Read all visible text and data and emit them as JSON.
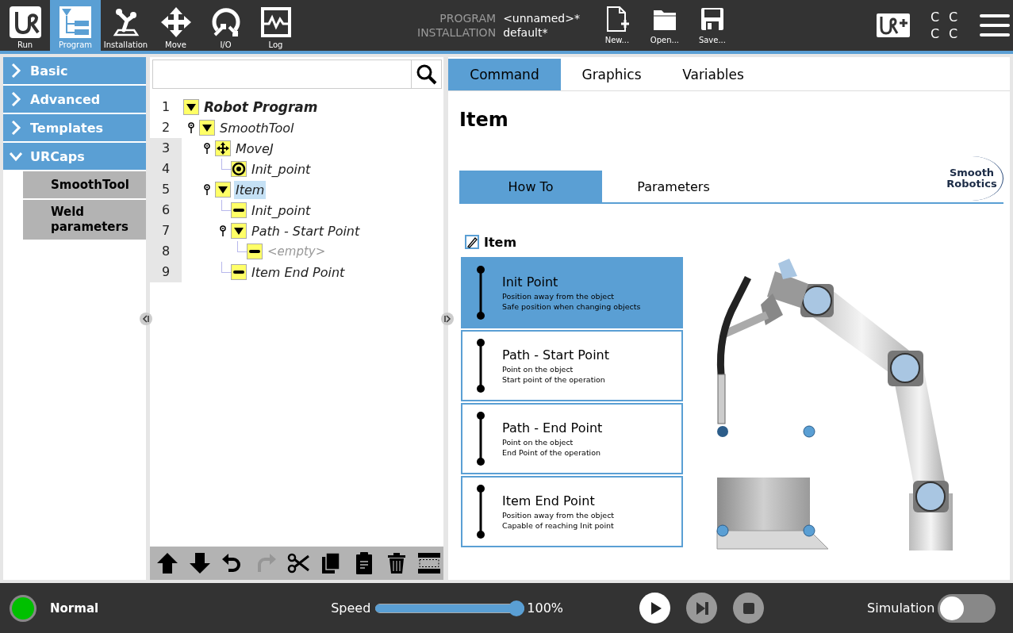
{
  "header": {
    "nav": [
      {
        "label": "Run",
        "kind": "run",
        "selected": false
      },
      {
        "label": "Program",
        "kind": "program",
        "selected": true
      },
      {
        "label": "Installation",
        "kind": "installation",
        "selected": false
      },
      {
        "label": "Move",
        "kind": "move",
        "selected": false
      },
      {
        "label": "I/O",
        "kind": "io",
        "selected": false
      },
      {
        "label": "Log",
        "kind": "log",
        "selected": false
      }
    ],
    "program": {
      "label": "PROGRAM",
      "value": "<unnamed>*"
    },
    "installation": {
      "label": "INSTALLATION",
      "value": "default*"
    },
    "file_buttons": [
      {
        "label": "New...",
        "kind": "new"
      },
      {
        "label": "Open...",
        "kind": "open"
      },
      {
        "label": "Save...",
        "kind": "save"
      }
    ],
    "status_letters": [
      "C",
      "C",
      "C",
      "C"
    ]
  },
  "sidebar": {
    "items": [
      {
        "label": "Basic",
        "expanded": false
      },
      {
        "label": "Advanced",
        "expanded": false
      },
      {
        "label": "Templates",
        "expanded": false
      },
      {
        "label": "URCaps",
        "expanded": true,
        "children": [
          {
            "label": "SmoothTool"
          },
          {
            "label": "Weld parameters"
          }
        ]
      }
    ]
  },
  "program_tree": {
    "nodes": [
      {
        "line": "1",
        "label": "Robot Program",
        "kind": "folder",
        "expanded": true,
        "shaded": false,
        "selected": false,
        "empty": false,
        "children": [
          {
            "line": "2",
            "label": "SmoothTool",
            "kind": "folder",
            "expanded": true,
            "shaded": false,
            "selected": false,
            "empty": false,
            "children": [
              {
                "line": "3",
                "label": "MoveJ",
                "kind": "move",
                "expanded": true,
                "shaded": true,
                "selected": false,
                "empty": false,
                "children": [
                  {
                    "line": "4",
                    "label": "Init_point",
                    "kind": "waypoint",
                    "shaded": true,
                    "selected": false,
                    "empty": false
                  }
                ]
              },
              {
                "line": "5",
                "label": "Item",
                "kind": "folder",
                "expanded": true,
                "shaded": true,
                "selected": true,
                "empty": false,
                "children": [
                  {
                    "line": "6",
                    "label": "Init_point",
                    "kind": "point",
                    "shaded": true,
                    "selected": false,
                    "empty": false
                  },
                  {
                    "line": "7",
                    "label": "Path - Start Point",
                    "kind": "folder",
                    "expanded": true,
                    "shaded": true,
                    "selected": false,
                    "empty": false,
                    "children": [
                      {
                        "line": "8",
                        "label": "<empty>",
                        "kind": "point",
                        "shaded": true,
                        "selected": false,
                        "empty": true
                      }
                    ]
                  },
                  {
                    "line": "9",
                    "label": "Item End Point",
                    "kind": "point",
                    "shaded": true,
                    "selected": false,
                    "empty": false
                  }
                ]
              }
            ]
          }
        ]
      }
    ]
  },
  "tree_toolbar": [
    {
      "kind": "up",
      "disabled": false
    },
    {
      "kind": "down",
      "disabled": false
    },
    {
      "kind": "undo",
      "disabled": false
    },
    {
      "kind": "redo",
      "disabled": true
    },
    {
      "kind": "cut",
      "disabled": false
    },
    {
      "kind": "copy",
      "disabled": false
    },
    {
      "kind": "paste",
      "disabled": false
    },
    {
      "kind": "delete",
      "disabled": false
    },
    {
      "kind": "suppress",
      "disabled": false
    }
  ],
  "tabs": [
    {
      "label": "Command",
      "selected": true
    },
    {
      "label": "Graphics",
      "selected": false
    },
    {
      "label": "Variables",
      "selected": false
    }
  ],
  "command": {
    "title": "Item",
    "subtabs": [
      {
        "label": "How To",
        "selected": true
      },
      {
        "label": "Parameters",
        "selected": false
      }
    ],
    "logo": [
      "Smooth",
      "Robotics"
    ],
    "node_header": "Item",
    "steps": [
      {
        "title": "Init Point",
        "lines": [
          "Position away from the object",
          "Safe position when changing objects"
        ],
        "selected": true
      },
      {
        "title": "Path - Start Point",
        "lines": [
          "Point on the object",
          "Start point of the operation"
        ],
        "selected": false
      },
      {
        "title": "Path - End Point",
        "lines": [
          "Point on the object",
          "End Point of the operation"
        ],
        "selected": false
      },
      {
        "title": "Item End Point",
        "lines": [
          "Position away from the object",
          "Capable of reaching Init point"
        ],
        "selected": false
      }
    ]
  },
  "footer": {
    "status": {
      "kind": "normal",
      "label": "Normal"
    },
    "speed": {
      "label": "Speed",
      "level": 1,
      "reading": "100%"
    },
    "controls": [
      {
        "kind": "play",
        "disabled": false
      },
      {
        "kind": "step",
        "disabled": true
      },
      {
        "kind": "stop",
        "disabled": true
      }
    ],
    "simulation": {
      "label": "Simulation",
      "on": false
    }
  }
}
